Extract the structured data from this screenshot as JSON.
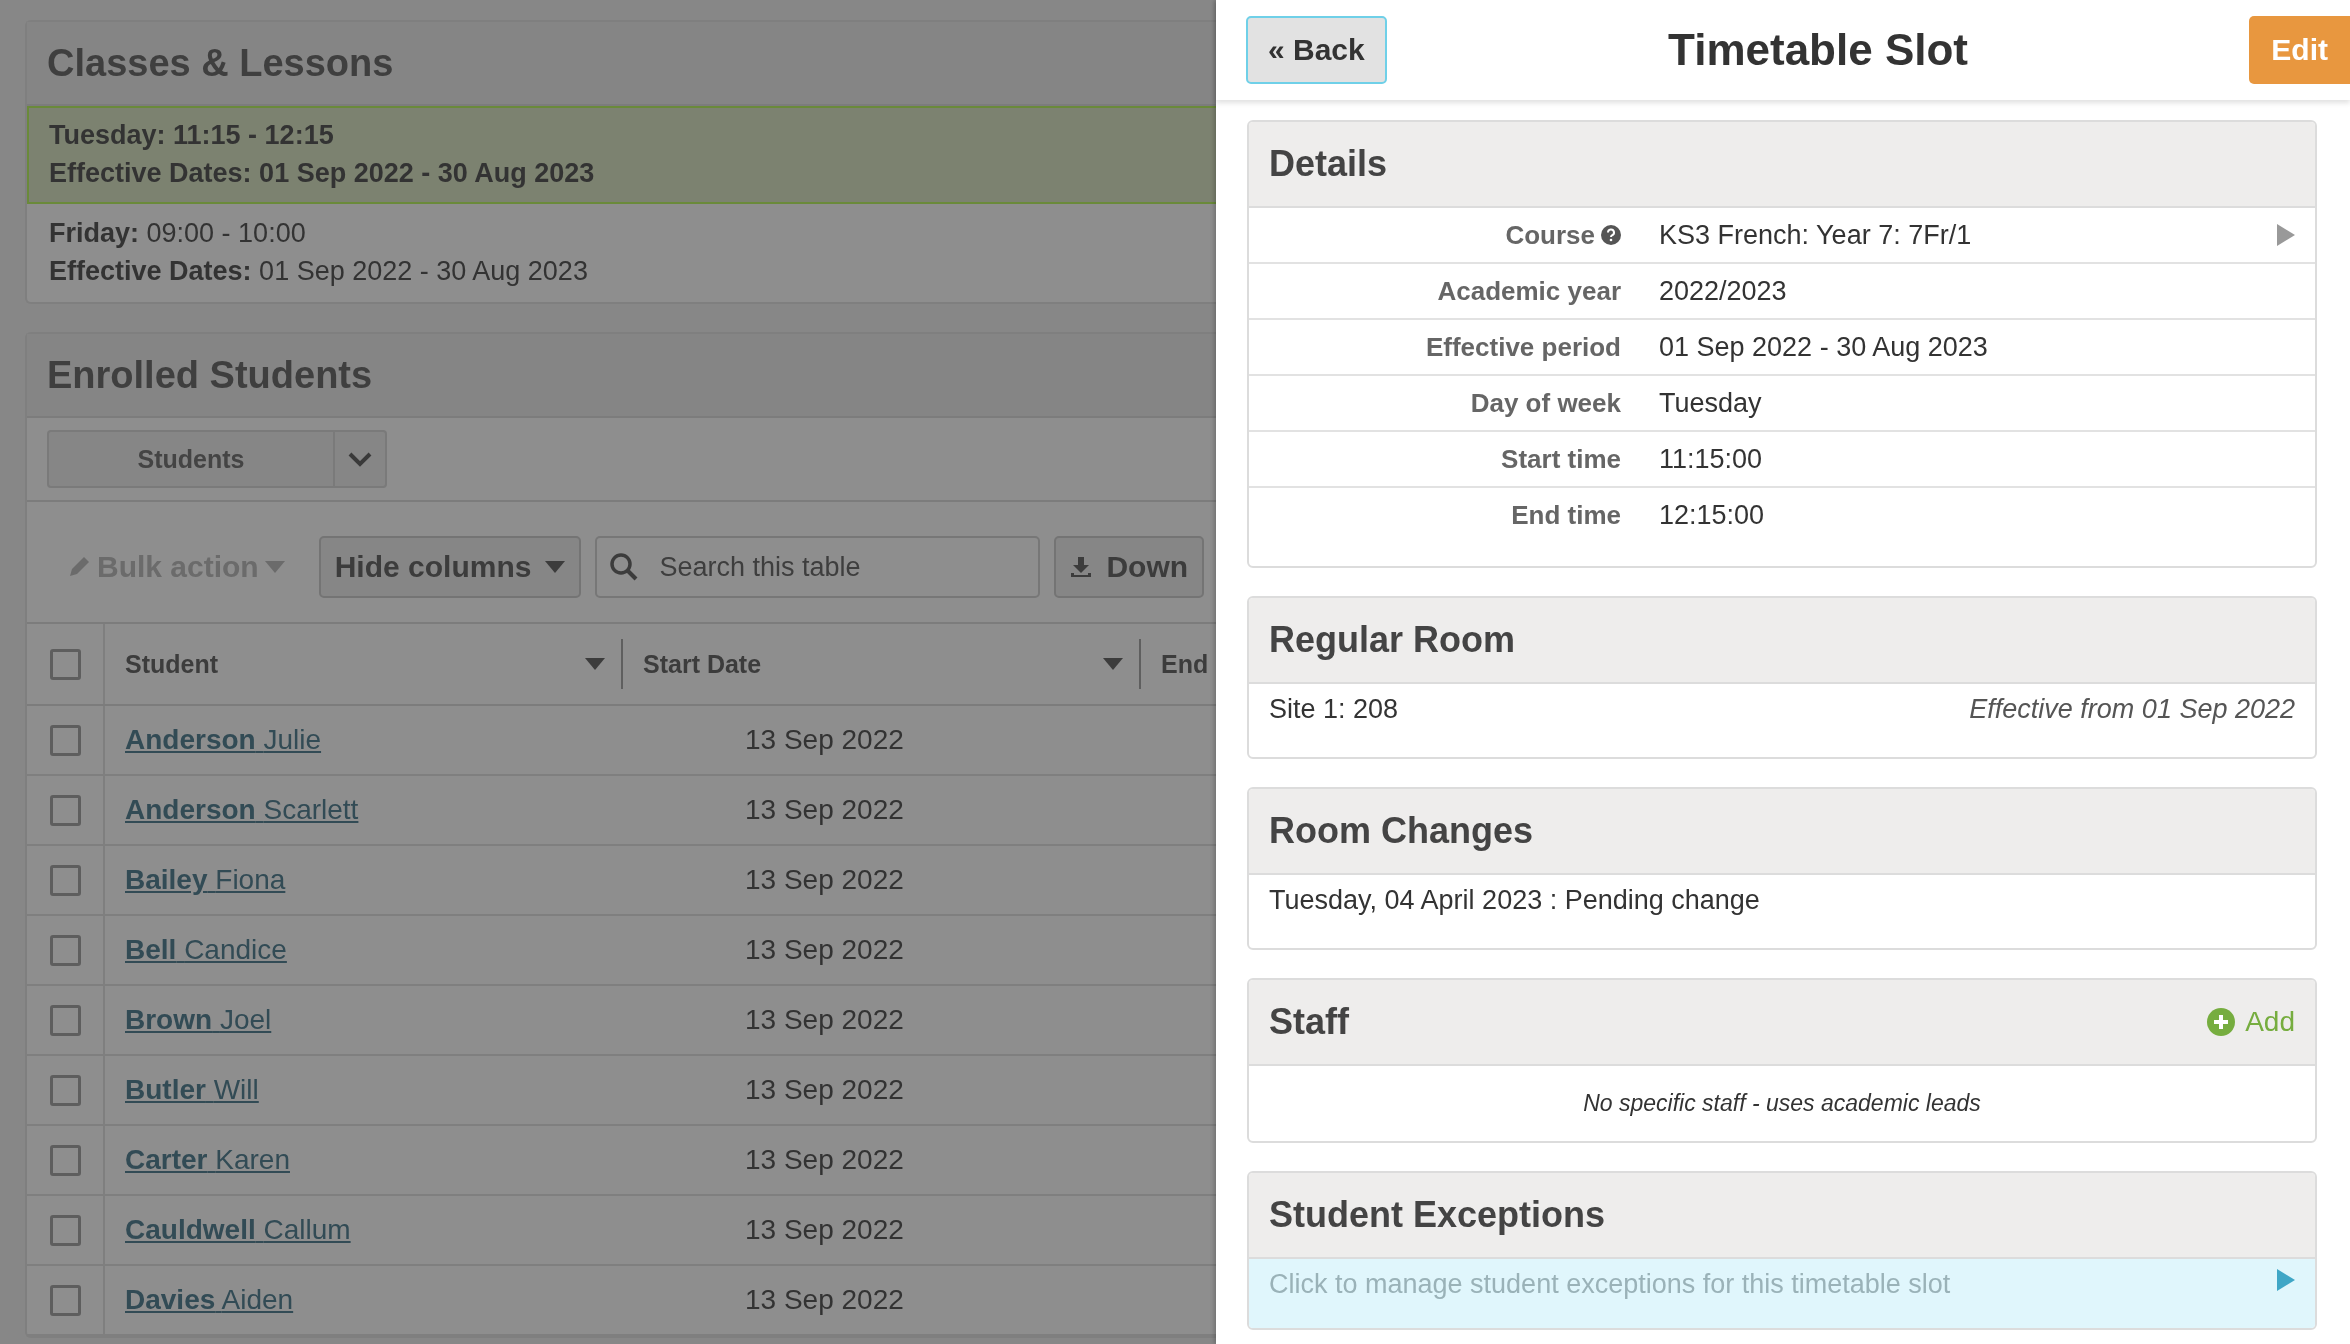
{
  "classes_lessons": {
    "title": "Classes & Lessons",
    "slots": [
      {
        "day": "Tuesday:",
        "time": "11:15 - 12:15",
        "dates_label": "Effective Dates:",
        "dates": "01 Sep 2022 - 30 Aug 2023",
        "selected": true
      },
      {
        "day": "Friday:",
        "time": "09:00 - 10:00",
        "dates_label": "Effective Dates:",
        "dates": "01 Sep 2022 - 30 Aug 2023",
        "selected": false
      }
    ]
  },
  "enrolled_students": {
    "title": "Enrolled Students",
    "view_select": "Students",
    "toolbar": {
      "bulk_action": "Bulk action",
      "hide_columns": "Hide columns",
      "search_placeholder": "Search this table",
      "download": "Down"
    },
    "table": {
      "select_all_checked": false,
      "columns": [
        {
          "label": "Student"
        },
        {
          "label": "Start Date"
        },
        {
          "label": "End"
        }
      ],
      "rows": [
        {
          "last": "Anderson",
          "first": "Julie",
          "start_date": "13 Sep 2022",
          "checked": false
        },
        {
          "last": "Anderson",
          "first": "Scarlett",
          "start_date": "13 Sep 2022",
          "checked": false
        },
        {
          "last": "Bailey",
          "first": "Fiona",
          "start_date": "13 Sep 2022",
          "checked": false
        },
        {
          "last": "Bell",
          "first": "Candice",
          "start_date": "13 Sep 2022",
          "checked": false
        },
        {
          "last": "Brown",
          "first": "Joel",
          "start_date": "13 Sep 2022",
          "checked": false
        },
        {
          "last": "Butler",
          "first": "Will",
          "start_date": "13 Sep 2022",
          "checked": false
        },
        {
          "last": "Carter",
          "first": "Karen",
          "start_date": "13 Sep 2022",
          "checked": false
        },
        {
          "last": "Cauldwell",
          "first": "Callum",
          "start_date": "13 Sep 2022",
          "checked": false
        },
        {
          "last": "Davies",
          "first": "Aiden",
          "start_date": "13 Sep 2022",
          "checked": false
        }
      ]
    }
  },
  "slot_panel": {
    "back": "« Back",
    "title": "Timetable Slot",
    "edit": "Edit",
    "details": {
      "title": "Details",
      "rows": [
        {
          "kind": "link",
          "label": "Course",
          "value": "KS3 French: Year 7: 7Fr/1"
        },
        {
          "kind": "plain",
          "label": "Academic year",
          "value": "2022/2023"
        },
        {
          "kind": "plain",
          "label": "Effective period",
          "value": "01 Sep 2022 - 30 Aug 2023"
        },
        {
          "kind": "plain",
          "label": "Day of week",
          "value": "Tuesday"
        },
        {
          "kind": "plain",
          "label": "Start time",
          "value": "11:15:00"
        },
        {
          "kind": "plain",
          "label": "End time",
          "value": "12:15:00"
        }
      ]
    },
    "regular_room": {
      "title": "Regular Room",
      "room": "Site 1: 208",
      "effective": "Effective from 01 Sep 2022"
    },
    "room_changes": {
      "title": "Room Changes",
      "items": [
        "Tuesday, 04 April 2023 : Pending change"
      ]
    },
    "staff": {
      "title": "Staff",
      "add": "Add",
      "empty": "No specific staff - uses academic leads"
    },
    "student_exceptions": {
      "title": "Student Exceptions",
      "link": "Click to manage student exceptions for this timetable slot"
    }
  }
}
